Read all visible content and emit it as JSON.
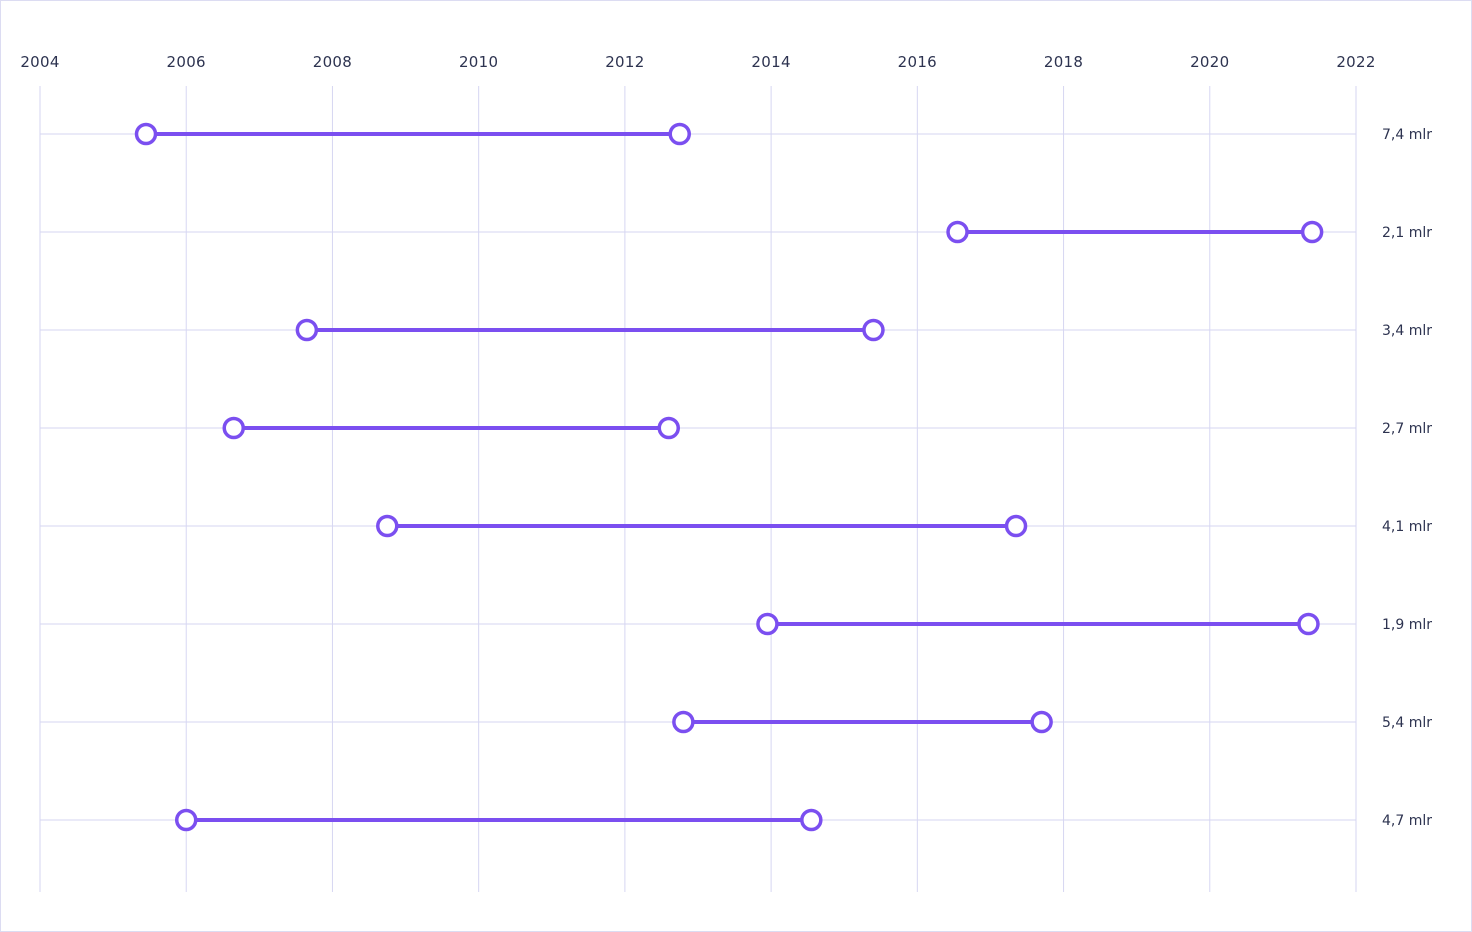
{
  "chart_data": {
    "type": "dumbbell",
    "x_axis": {
      "ticks": [
        2004,
        2006,
        2008,
        2010,
        2012,
        2014,
        2016,
        2018,
        2020,
        2022
      ],
      "range": [
        2004,
        2022
      ],
      "position": "top"
    },
    "grid": true,
    "rows": [
      {
        "start": 2005.45,
        "end": 2012.75,
        "label": "7,4 mlr"
      },
      {
        "start": 2016.55,
        "end": 2021.4,
        "label": "2,1 mlr"
      },
      {
        "start": 2007.65,
        "end": 2015.4,
        "label": "3,4 mlr"
      },
      {
        "start": 2006.65,
        "end": 2012.6,
        "label": "2,7 mlr"
      },
      {
        "start": 2008.75,
        "end": 2017.35,
        "label": "4,1 mlr"
      },
      {
        "start": 2013.95,
        "end": 2021.35,
        "label": "1,9 mlr"
      },
      {
        "start": 2012.8,
        "end": 2017.7,
        "label": "5,4 mlr"
      },
      {
        "start": 2006.0,
        "end": 2014.55,
        "label": "4,7 mlr"
      }
    ],
    "colors": {
      "line": "#7b4ff0",
      "grid": "#d6d6f2",
      "text": "#2d3350",
      "marker_fill": "#ffffff"
    }
  }
}
